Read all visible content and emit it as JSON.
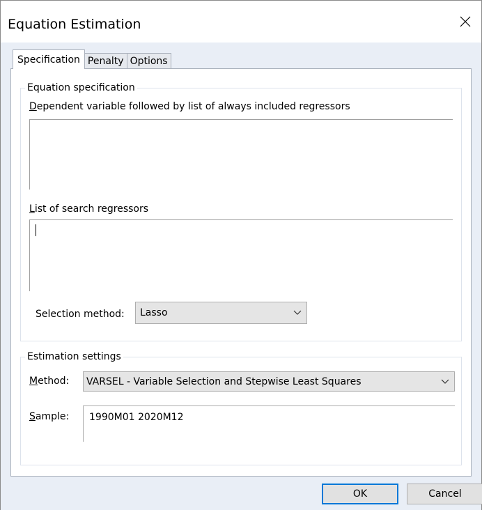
{
  "window": {
    "title": "Equation Estimation"
  },
  "tabs": [
    {
      "label": "Specification",
      "active": true
    },
    {
      "label": "Penalty",
      "active": false
    },
    {
      "label": "Options",
      "active": false
    }
  ],
  "equation_spec": {
    "legend": "Equation specification",
    "dependent_label_key": "D",
    "dependent_label_rest": "ependent variable followed by list of always included regressors",
    "dependent_value": "",
    "search_label_key": "L",
    "search_label_rest": "ist of search regressors",
    "search_value": "",
    "selection_method_label": "Selection method:",
    "selection_method_value": "Lasso"
  },
  "estimation_settings": {
    "legend": "Estimation settings",
    "method_label_key": "M",
    "method_label_rest": "ethod:",
    "method_value": "VARSEL  -  Variable Selection and Stepwise Least Squares",
    "sample_label_key": "S",
    "sample_label_rest": "ample:",
    "sample_value": "1990M01 2020M12"
  },
  "buttons": {
    "ok": "OK",
    "cancel": "Cancel"
  },
  "icons": {
    "close": "close-icon",
    "dropdown": "chevron-down-icon"
  },
  "colors": {
    "accent": "#0078d7",
    "client_bg": "#e9eef6"
  }
}
